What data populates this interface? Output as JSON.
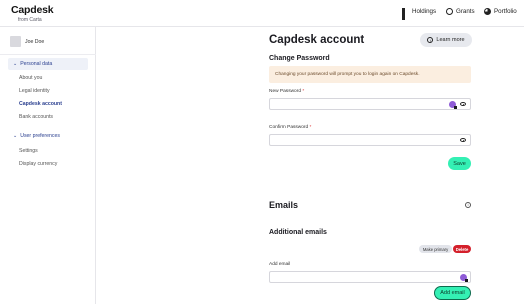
{
  "header": {
    "logo": "Capdesk",
    "logo_sub": "from Carta",
    "nav": [
      {
        "label": "Holdings",
        "icon": "grid-icon"
      },
      {
        "label": "Grants",
        "icon": "circle-icon"
      },
      {
        "label": "Portfolio",
        "icon": "pie-chart-icon"
      }
    ]
  },
  "sidebar": {
    "user_name": "Joe Doe",
    "groups": [
      {
        "label": "Personal data",
        "items": [
          "About you",
          "Legal identity",
          "Capdesk account",
          "Bank accounts"
        ]
      },
      {
        "label": "User preferences",
        "items": [
          "Settings",
          "Display currency"
        ]
      }
    ],
    "current_item": "Capdesk account"
  },
  "main": {
    "title": "Capdesk account",
    "learn_more": "Learn more",
    "change_password": {
      "title": "Change Password",
      "warning": "Changing your password will prompt you to login again on Capdesk.",
      "new_password_label": "New Password",
      "confirm_password_label": "Confirm Password",
      "required_mark": "*",
      "save_label": "Save"
    },
    "emails": {
      "title": "Emails",
      "additional_title": "Additional emails",
      "make_primary": "Make primary",
      "delete": "Delete",
      "add_email_label": "Add email",
      "add_email_button": "Add email"
    }
  },
  "colors": {
    "accent_green": "#34f0b4",
    "link_blue": "#2a3f8f",
    "warning_bg": "#fbeee0",
    "danger": "#d4202b"
  }
}
